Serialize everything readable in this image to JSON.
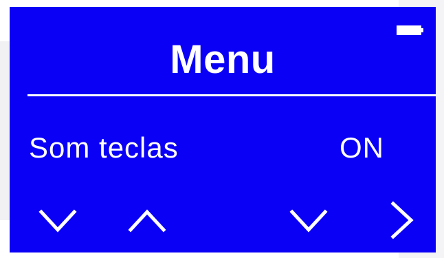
{
  "colors": {
    "screen_background": "#0a00f5",
    "foreground": "#ffffff"
  },
  "status": {
    "battery_icon": "battery-full-icon"
  },
  "header": {
    "title": "Menu"
  },
  "menu_item": {
    "label": "Som teclas",
    "value": "ON"
  },
  "controls": [
    {
      "name": "down-arrow-icon",
      "action": "down"
    },
    {
      "name": "up-arrow-icon",
      "action": "up"
    },
    {
      "name": "chevron-down-icon",
      "action": "down"
    },
    {
      "name": "chevron-right-icon",
      "action": "right"
    }
  ]
}
